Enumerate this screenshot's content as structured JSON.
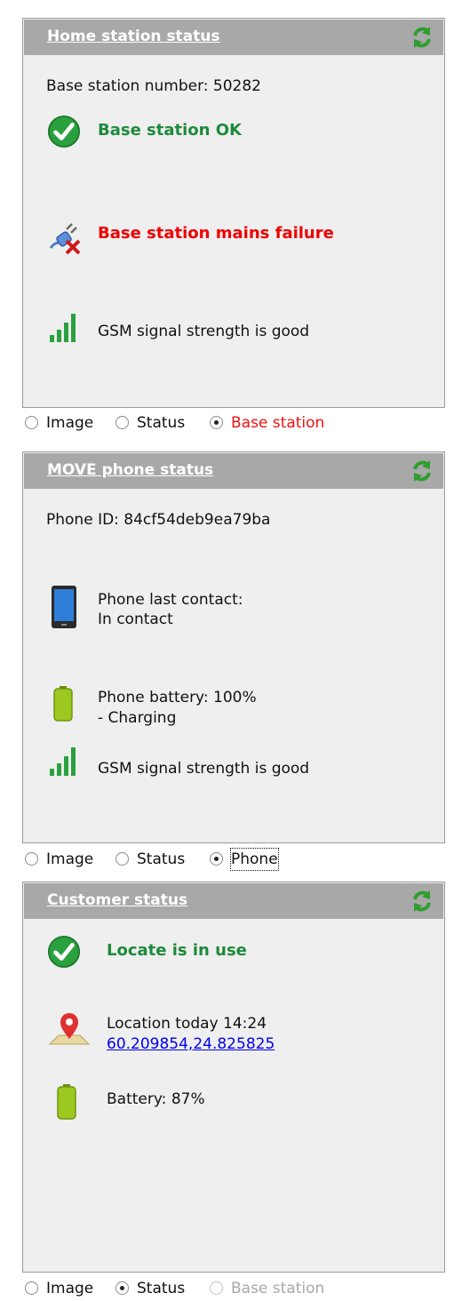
{
  "home": {
    "title": "Home station status",
    "base_number": "Base station number: 50282",
    "ok_text": "Base station OK",
    "mains_text": "Base station mains failure",
    "gsm_text": "GSM signal strength is good",
    "radios": [
      "Image",
      "Status",
      "Base station"
    ],
    "selected": "Base station"
  },
  "phone": {
    "title": "MOVE phone status",
    "phone_id": "Phone ID: 84cf54deb9ea79ba",
    "last_contact_label": "Phone last contact:",
    "last_contact_value": "In contact",
    "battery_label": "Phone battery: 100%",
    "battery_state": "- Charging",
    "gsm_text": "GSM signal strength is good",
    "radios": [
      "Image",
      "Status",
      "Phone"
    ],
    "selected": "Phone"
  },
  "customer": {
    "title": "Customer status",
    "locate_text": "Locate is in use",
    "location_label": "Location today 14:24",
    "location_coords": "60.209854,24.825825",
    "battery_text": "Battery: 87%",
    "radios": [
      "Image",
      "Status",
      "Base station"
    ],
    "selected": "Status"
  },
  "colors": {
    "ok_green": "#1e8a3c",
    "fail_red": "#ee0000",
    "header_gray": "#a8a8a8",
    "panel_bg": "#efefef",
    "link_blue": "#0000ee"
  },
  "icons": [
    "refresh-icon",
    "check-circle-icon",
    "plug-failure-icon",
    "signal-bars-icon",
    "phone-device-icon",
    "battery-icon",
    "map-pin-icon"
  ]
}
